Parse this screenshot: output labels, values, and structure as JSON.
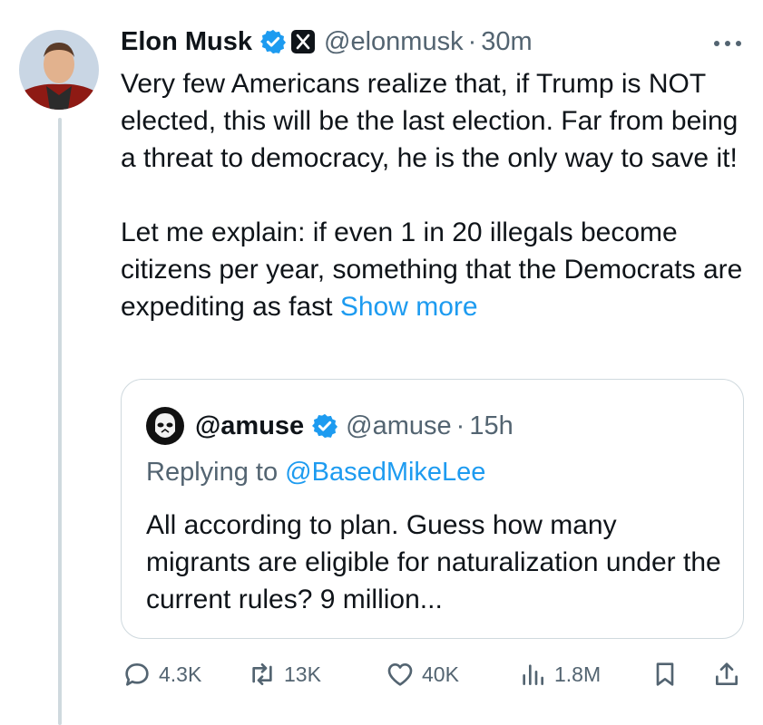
{
  "tweet": {
    "author_name": "Elon Musk",
    "handle": "@elonmusk",
    "separator": "·",
    "time": "30m",
    "paragraph1": "Very few Americans realize that, if Trump is NOT elected, this will be the last election. Far from being a threat to democracy, he is the only way to save it!",
    "paragraph2": "Let me explain: if even 1 in 20 illegals become citizens per year, something that the Democrats are expediting as fast",
    "show_more": "Show more"
  },
  "quote": {
    "author_name": "@amuse",
    "handle": "@amuse",
    "separator": "·",
    "time": "15h",
    "replying_prefix": "Replying to",
    "replying_to": "@BasedMikeLee",
    "text": "All according to plan. Guess how many migrants are eligible for naturalization under the current rules? 9 million..."
  },
  "actions": {
    "replies": "4.3K",
    "reposts": "13K",
    "likes": "40K",
    "views": "1.8M"
  },
  "icons": [
    "verified-badge-icon",
    "x-affiliate-icon",
    "more-icon",
    "reply-icon",
    "repost-icon",
    "like-icon",
    "views-icon",
    "bookmark-icon",
    "share-icon"
  ],
  "colors": {
    "accent": "#1d9bf0",
    "muted": "#536471",
    "text": "#0f1419",
    "border": "#cfd9de"
  }
}
